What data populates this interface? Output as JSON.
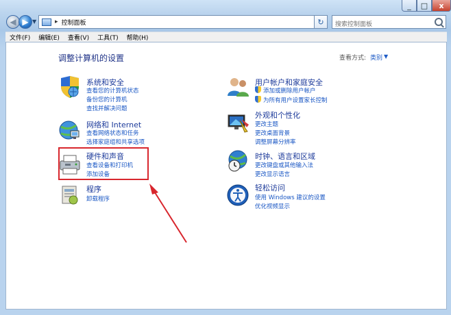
{
  "window": {
    "close_glyph": "x",
    "max_glyph": "□",
    "min_glyph": "_"
  },
  "address": {
    "path": "控制面板",
    "separator": "▸"
  },
  "search": {
    "placeholder": "搜索控制面板"
  },
  "menubar": [
    "文件(F)",
    "编辑(E)",
    "查看(V)",
    "工具(T)",
    "帮助(H)"
  ],
  "page": {
    "title": "调整计算机的设置",
    "view_by_label": "查看方式:",
    "view_by_value": "类别"
  },
  "categories": {
    "system": {
      "title": "系统和安全",
      "icon": "shield-globe-icon",
      "links": [
        "查看您的计算机状态",
        "备份您的计算机",
        "查找并解决问题"
      ]
    },
    "network": {
      "title": "网络和 Internet",
      "icon": "network-globe-icon",
      "links": [
        "查看网络状态和任务",
        "选择家庭组和共享选项"
      ]
    },
    "hardware": {
      "title": "硬件和声音",
      "icon": "printer-icon",
      "links": [
        "查看设备和打印机",
        "添加设备"
      ]
    },
    "programs": {
      "title": "程序",
      "icon": "programs-icon",
      "links": [
        "卸载程序"
      ]
    },
    "users": {
      "title": "用户帐户和家庭安全",
      "icon": "users-icon",
      "links": [
        "添加或删除用户帐户",
        "为所有用户设置家长控制"
      ]
    },
    "appearance": {
      "title": "外观和个性化",
      "icon": "display-icon",
      "links": [
        "更改主题",
        "更改桌面背景",
        "调整屏幕分辨率"
      ]
    },
    "clock": {
      "title": "时钟、语言和区域",
      "icon": "clock-globe-icon",
      "links": [
        "更改键盘或其他输入法",
        "更改显示语言"
      ]
    },
    "access": {
      "title": "轻松访问",
      "icon": "ease-of-access-icon",
      "links": [
        "使用 Windows 建议的设置",
        "优化视频显示"
      ]
    }
  },
  "colors": {
    "highlight": "#d8262d",
    "link": "#1a57c4",
    "category_title": "#1c3a9a"
  }
}
